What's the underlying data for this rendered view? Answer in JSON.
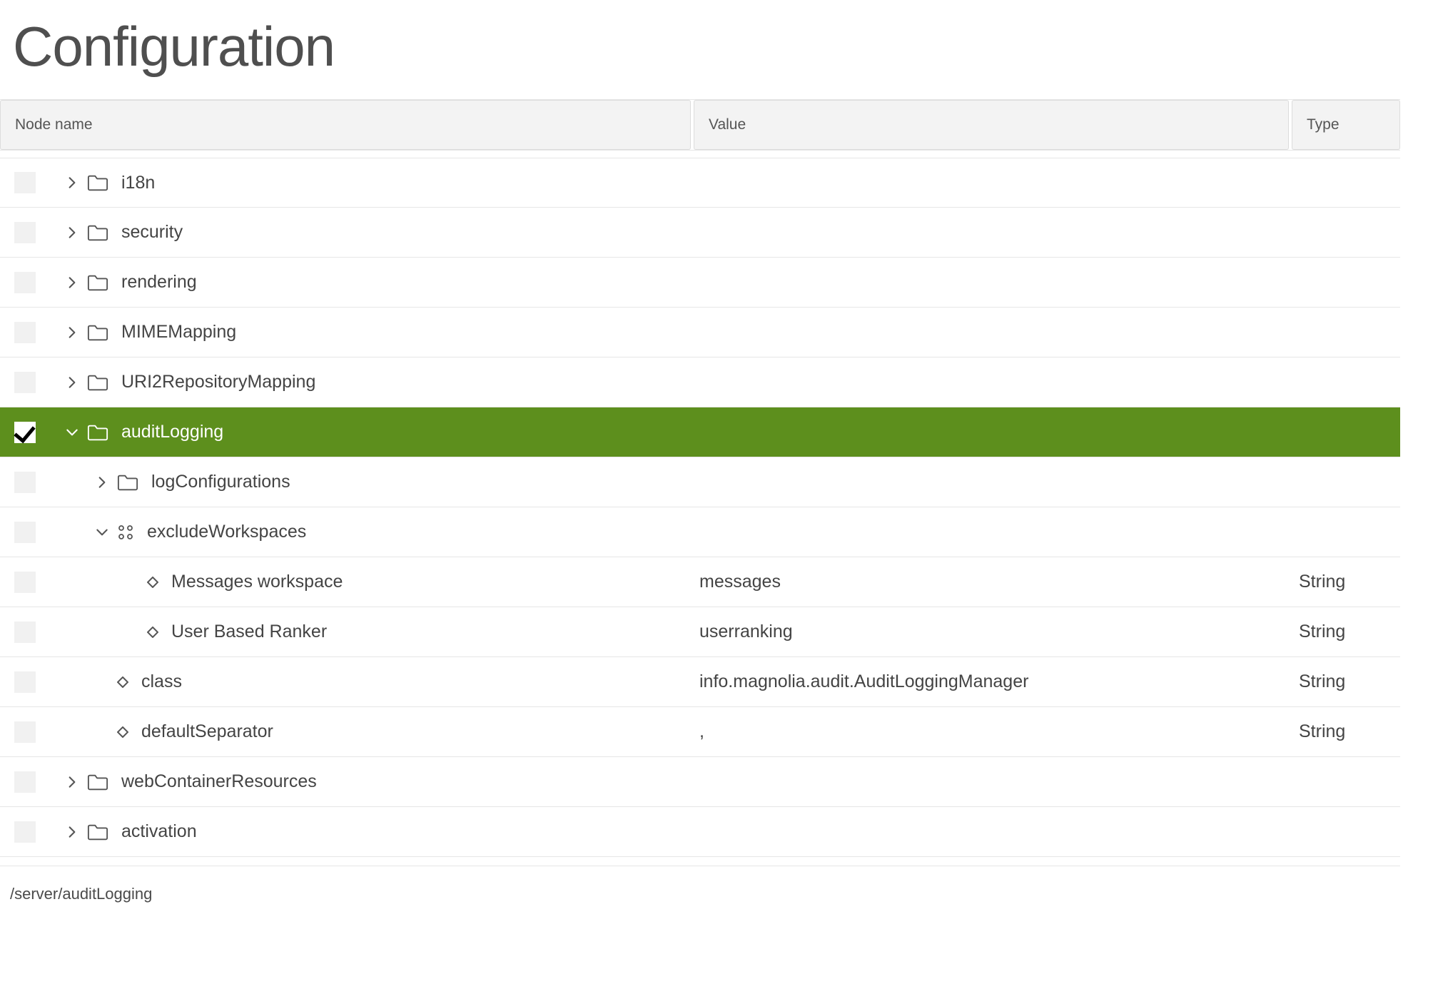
{
  "title": "Configuration",
  "columns": {
    "name": "Node name",
    "value": "Value",
    "type": "Type"
  },
  "rows": [
    {
      "indent": 0,
      "checked": false,
      "selected": false,
      "caret": "right",
      "icon": "folder",
      "label": "i18n"
    },
    {
      "indent": 0,
      "checked": false,
      "selected": false,
      "caret": "right",
      "icon": "folder",
      "label": "security"
    },
    {
      "indent": 0,
      "checked": false,
      "selected": false,
      "caret": "right",
      "icon": "folder",
      "label": "rendering"
    },
    {
      "indent": 0,
      "checked": false,
      "selected": false,
      "caret": "right",
      "icon": "folder",
      "label": "MIMEMapping"
    },
    {
      "indent": 0,
      "checked": false,
      "selected": false,
      "caret": "right",
      "icon": "folder",
      "label": "URI2RepositoryMapping"
    },
    {
      "indent": 0,
      "checked": true,
      "selected": true,
      "caret": "down",
      "icon": "folder",
      "label": "auditLogging"
    },
    {
      "indent": 1,
      "checked": false,
      "selected": false,
      "caret": "right",
      "icon": "folder",
      "label": "logConfigurations"
    },
    {
      "indent": 1,
      "checked": false,
      "selected": false,
      "caret": "down",
      "icon": "content",
      "label": "excludeWorkspaces"
    },
    {
      "indent": 2,
      "checked": false,
      "selected": false,
      "caret": "none",
      "icon": "diamond",
      "label": "Messages workspace",
      "value": "messages",
      "type": "String"
    },
    {
      "indent": 2,
      "checked": false,
      "selected": false,
      "caret": "none",
      "icon": "diamond",
      "label": "User Based Ranker",
      "value": "userranking",
      "type": "String"
    },
    {
      "indent": 1,
      "checked": false,
      "selected": false,
      "caret": "none",
      "icon": "diamond",
      "label": "class",
      "value": "info.magnolia.audit.AuditLoggingManager",
      "type": "String"
    },
    {
      "indent": 1,
      "checked": false,
      "selected": false,
      "caret": "none",
      "icon": "diamond",
      "label": "defaultSeparator",
      "value": ",",
      "type": "String"
    },
    {
      "indent": 0,
      "checked": false,
      "selected": false,
      "caret": "right",
      "icon": "folder",
      "label": "webContainerResources"
    },
    {
      "indent": 0,
      "checked": false,
      "selected": false,
      "caret": "right",
      "icon": "folder",
      "label": "activation"
    }
  ],
  "path": "/server/auditLogging",
  "indentStep": 42,
  "baseIndent": 40
}
